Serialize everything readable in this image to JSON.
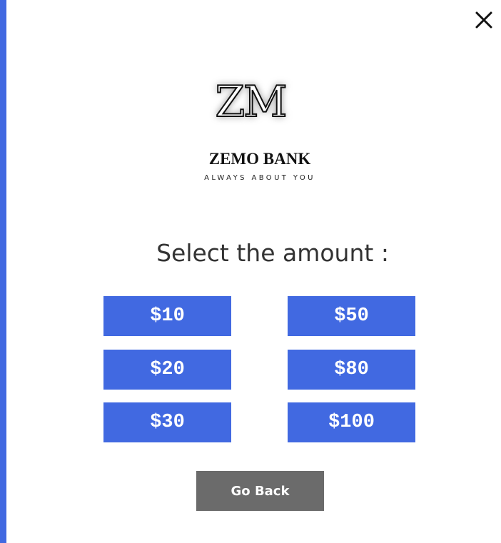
{
  "brand": {
    "logo_text": "ZM",
    "name": "ZEMO BANK",
    "tagline": "ALWAYS ABOUT YOU",
    "accent_color": "#4169e1"
  },
  "prompt": "Select the amount :",
  "amounts": {
    "a10": "$10",
    "a50": "$50",
    "a20": "$20",
    "a80": "$80",
    "a30": "$30",
    "a100": "$100"
  },
  "go_back_label": "Go Back",
  "close_icon": "close-icon",
  "colors": {
    "button": "#4169e1",
    "secondary_button": "#6b6b6b",
    "text": "#333333"
  }
}
